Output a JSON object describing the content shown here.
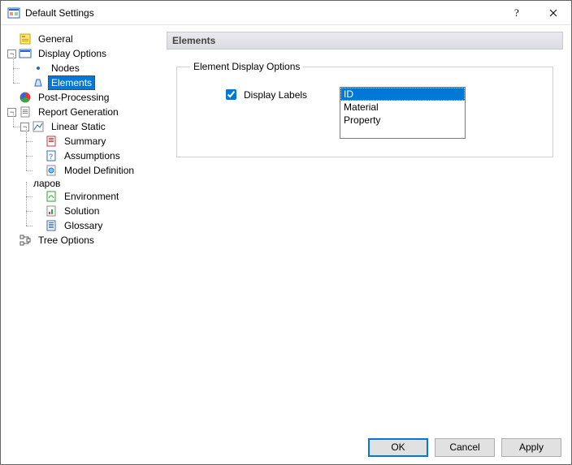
{
  "window": {
    "title": "Default Settings"
  },
  "tree": {
    "general": "General",
    "display_options": "Display Options",
    "nodes": "Nodes",
    "elements": "Elements",
    "post_processing": "Post-Processing",
    "report_generation": "Report Generation",
    "linear_static": "Linear Static",
    "summary": "Summary",
    "assumptions": "Assumptions",
    "model_definition": "Model Definition",
    "environment": "Environment",
    "solution": "Solution",
    "glossary": "Glossary",
    "tree_options": "Tree Options"
  },
  "panel": {
    "title": "Elements",
    "groupbox": "Element Display Options",
    "display_labels": "Display Labels",
    "display_labels_checked": true,
    "list": [
      "ID",
      "Material",
      "Property"
    ],
    "list_selected_index": 0
  },
  "buttons": {
    "ok": "OK",
    "cancel": "Cancel",
    "apply": "Apply"
  }
}
